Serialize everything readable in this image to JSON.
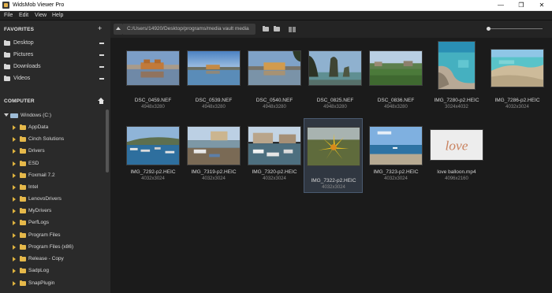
{
  "window": {
    "title": "WidsMob Viewer Pro",
    "minimize": "—",
    "maximize": "❐",
    "close": "✕"
  },
  "menu": [
    "File",
    "Edit",
    "View",
    "Help"
  ],
  "sidebar": {
    "favorites_header": "FAVORITES",
    "favorites": [
      "Desktop",
      "Pictures",
      "Downloads",
      "Videos"
    ],
    "computer_header": "COMPUTER",
    "drive": "Windows (C:)",
    "folders": [
      "AppData",
      "Cinch Solutions",
      "Drivers",
      "ESD",
      "Foxmail 7.2",
      "Intel",
      "LenovoDrivers",
      "MyDrivers",
      "PerfLogs",
      "Program Files",
      "Program Files (x86)",
      "Release - Copy",
      "SadpLog",
      "SnapPlugin"
    ]
  },
  "toolbar": {
    "path": "C:/Users/14920/Desktop/programs/media vault media"
  },
  "files": [
    {
      "name": "DSC_0459.NEF",
      "dims": "4948x3280"
    },
    {
      "name": "DSC_0539.NEF",
      "dims": "4948x3280"
    },
    {
      "name": "DSC_0540.NEF",
      "dims": "4948x3280"
    },
    {
      "name": "DSC_0825.NEF",
      "dims": "4948x3280"
    },
    {
      "name": "DSC_0836.NEF",
      "dims": "4948x3280"
    },
    {
      "name": "IMG_7280-p2.HEIC",
      "dims": "3024x4032"
    },
    {
      "name": "IMG_7286-p2.HEIC",
      "dims": "4032x3024"
    },
    {
      "name": "IMG_7292-p2.HEIC",
      "dims": "4032x3024"
    },
    {
      "name": "IMG_7319-p2.HEIC",
      "dims": "4032x3024"
    },
    {
      "name": "IMG_7320-p2.HEIC",
      "dims": "4032x3024"
    },
    {
      "name": "IMG_7322-p2.HEIC",
      "dims": "4032x3024",
      "selected": true
    },
    {
      "name": "IMG_7323-p2.HEIC",
      "dims": "4032x3024"
    },
    {
      "name": "love balloon.mp4",
      "dims": "4096x2160"
    }
  ],
  "colors": {
    "folder": "#e5b84a",
    "selection": "#303741",
    "background": "#1b1b1b"
  }
}
